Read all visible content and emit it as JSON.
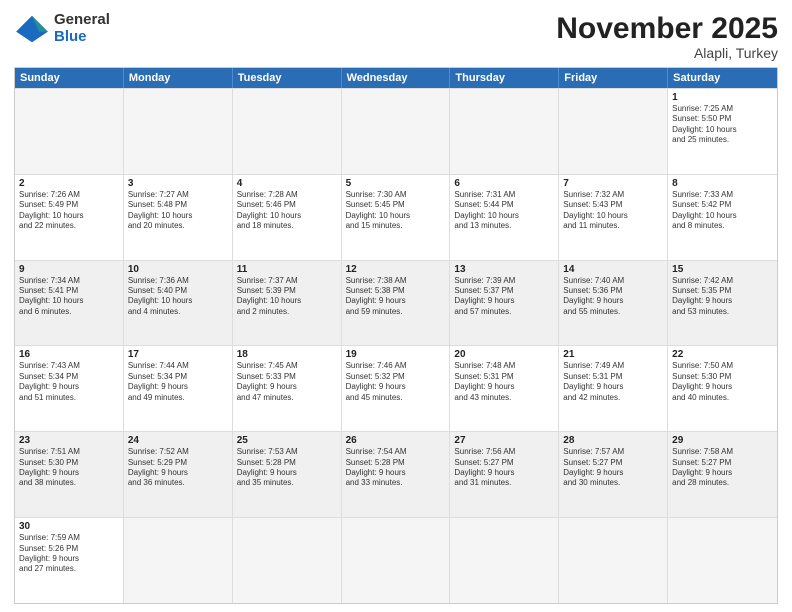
{
  "header": {
    "logo_general": "General",
    "logo_blue": "Blue",
    "month_title": "November 2025",
    "location": "Alapli, Turkey"
  },
  "weekdays": [
    "Sunday",
    "Monday",
    "Tuesday",
    "Wednesday",
    "Thursday",
    "Friday",
    "Saturday"
  ],
  "rows": [
    [
      {
        "day": "",
        "empty": true
      },
      {
        "day": "",
        "empty": true
      },
      {
        "day": "",
        "empty": true
      },
      {
        "day": "",
        "empty": true
      },
      {
        "day": "",
        "empty": true
      },
      {
        "day": "",
        "empty": true
      },
      {
        "day": "1",
        "text": "Sunrise: 7:25 AM\nSunset: 5:50 PM\nDaylight: 10 hours\nand 25 minutes."
      }
    ],
    [
      {
        "day": "2",
        "text": "Sunrise: 7:26 AM\nSunset: 5:49 PM\nDaylight: 10 hours\nand 22 minutes."
      },
      {
        "day": "3",
        "text": "Sunrise: 7:27 AM\nSunset: 5:48 PM\nDaylight: 10 hours\nand 20 minutes."
      },
      {
        "day": "4",
        "text": "Sunrise: 7:28 AM\nSunset: 5:46 PM\nDaylight: 10 hours\nand 18 minutes."
      },
      {
        "day": "5",
        "text": "Sunrise: 7:30 AM\nSunset: 5:45 PM\nDaylight: 10 hours\nand 15 minutes."
      },
      {
        "day": "6",
        "text": "Sunrise: 7:31 AM\nSunset: 5:44 PM\nDaylight: 10 hours\nand 13 minutes."
      },
      {
        "day": "7",
        "text": "Sunrise: 7:32 AM\nSunset: 5:43 PM\nDaylight: 10 hours\nand 11 minutes."
      },
      {
        "day": "8",
        "text": "Sunrise: 7:33 AM\nSunset: 5:42 PM\nDaylight: 10 hours\nand 8 minutes."
      }
    ],
    [
      {
        "day": "9",
        "shaded": true,
        "text": "Sunrise: 7:34 AM\nSunset: 5:41 PM\nDaylight: 10 hours\nand 6 minutes."
      },
      {
        "day": "10",
        "shaded": true,
        "text": "Sunrise: 7:36 AM\nSunset: 5:40 PM\nDaylight: 10 hours\nand 4 minutes."
      },
      {
        "day": "11",
        "shaded": true,
        "text": "Sunrise: 7:37 AM\nSunset: 5:39 PM\nDaylight: 10 hours\nand 2 minutes."
      },
      {
        "day": "12",
        "shaded": true,
        "text": "Sunrise: 7:38 AM\nSunset: 5:38 PM\nDaylight: 9 hours\nand 59 minutes."
      },
      {
        "day": "13",
        "shaded": true,
        "text": "Sunrise: 7:39 AM\nSunset: 5:37 PM\nDaylight: 9 hours\nand 57 minutes."
      },
      {
        "day": "14",
        "shaded": true,
        "text": "Sunrise: 7:40 AM\nSunset: 5:36 PM\nDaylight: 9 hours\nand 55 minutes."
      },
      {
        "day": "15",
        "shaded": true,
        "text": "Sunrise: 7:42 AM\nSunset: 5:35 PM\nDaylight: 9 hours\nand 53 minutes."
      }
    ],
    [
      {
        "day": "16",
        "text": "Sunrise: 7:43 AM\nSunset: 5:34 PM\nDaylight: 9 hours\nand 51 minutes."
      },
      {
        "day": "17",
        "text": "Sunrise: 7:44 AM\nSunset: 5:34 PM\nDaylight: 9 hours\nand 49 minutes."
      },
      {
        "day": "18",
        "text": "Sunrise: 7:45 AM\nSunset: 5:33 PM\nDaylight: 9 hours\nand 47 minutes."
      },
      {
        "day": "19",
        "text": "Sunrise: 7:46 AM\nSunset: 5:32 PM\nDaylight: 9 hours\nand 45 minutes."
      },
      {
        "day": "20",
        "text": "Sunrise: 7:48 AM\nSunset: 5:31 PM\nDaylight: 9 hours\nand 43 minutes."
      },
      {
        "day": "21",
        "text": "Sunrise: 7:49 AM\nSunset: 5:31 PM\nDaylight: 9 hours\nand 42 minutes."
      },
      {
        "day": "22",
        "text": "Sunrise: 7:50 AM\nSunset: 5:30 PM\nDaylight: 9 hours\nand 40 minutes."
      }
    ],
    [
      {
        "day": "23",
        "shaded": true,
        "text": "Sunrise: 7:51 AM\nSunset: 5:30 PM\nDaylight: 9 hours\nand 38 minutes."
      },
      {
        "day": "24",
        "shaded": true,
        "text": "Sunrise: 7:52 AM\nSunset: 5:29 PM\nDaylight: 9 hours\nand 36 minutes."
      },
      {
        "day": "25",
        "shaded": true,
        "text": "Sunrise: 7:53 AM\nSunset: 5:28 PM\nDaylight: 9 hours\nand 35 minutes."
      },
      {
        "day": "26",
        "shaded": true,
        "text": "Sunrise: 7:54 AM\nSunset: 5:28 PM\nDaylight: 9 hours\nand 33 minutes."
      },
      {
        "day": "27",
        "shaded": true,
        "text": "Sunrise: 7:56 AM\nSunset: 5:27 PM\nDaylight: 9 hours\nand 31 minutes."
      },
      {
        "day": "28",
        "shaded": true,
        "text": "Sunrise: 7:57 AM\nSunset: 5:27 PM\nDaylight: 9 hours\nand 30 minutes."
      },
      {
        "day": "29",
        "shaded": true,
        "text": "Sunrise: 7:58 AM\nSunset: 5:27 PM\nDaylight: 9 hours\nand 28 minutes."
      }
    ],
    [
      {
        "day": "30",
        "text": "Sunrise: 7:59 AM\nSunset: 5:26 PM\nDaylight: 9 hours\nand 27 minutes."
      },
      {
        "day": "",
        "empty": true
      },
      {
        "day": "",
        "empty": true
      },
      {
        "day": "",
        "empty": true
      },
      {
        "day": "",
        "empty": true
      },
      {
        "day": "",
        "empty": true
      },
      {
        "day": "",
        "empty": true
      }
    ]
  ]
}
